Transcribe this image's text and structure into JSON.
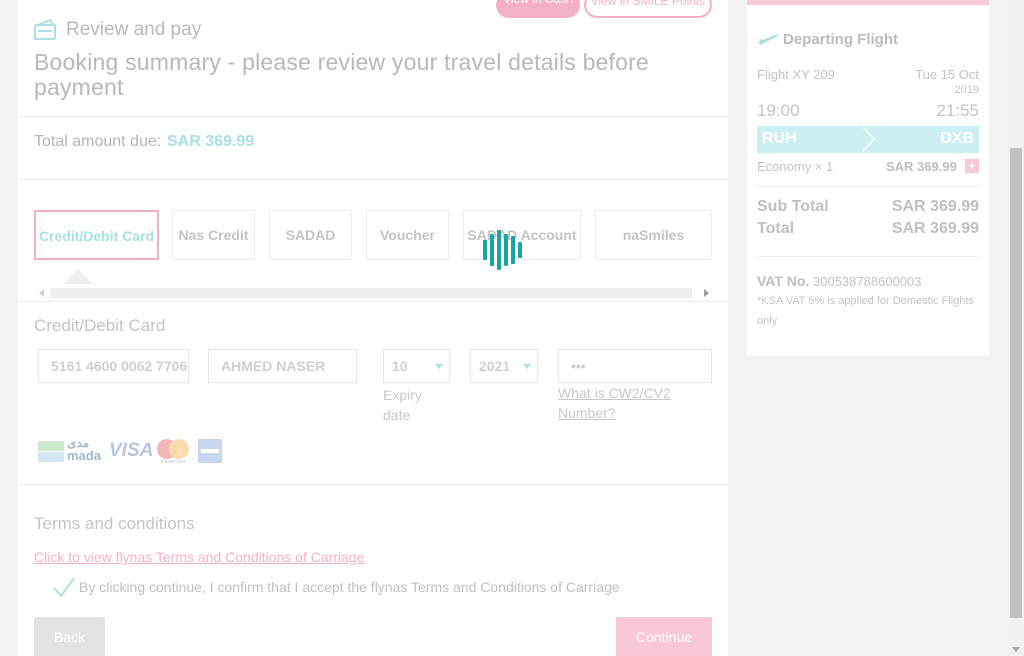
{
  "header": {
    "view_cash": "View in Cash",
    "view_points": "View in SMILE Points",
    "review_title": "Review and pay",
    "booking_title": "Booking summary - please review your travel details before payment"
  },
  "summary": {
    "total_label": "Total amount due:",
    "total_value": "SAR 369.99"
  },
  "payment_tabs": [
    {
      "label": "Credit/Debit Card",
      "active": true
    },
    {
      "label": "Nas Credit",
      "active": false
    },
    {
      "label": "SADAD",
      "active": false
    },
    {
      "label": "Voucher",
      "active": false
    },
    {
      "label": "SADAD Account",
      "active": false
    },
    {
      "label": "naSmiles",
      "active": false
    }
  ],
  "card_form": {
    "section_title": "Credit/Debit Card",
    "card_number": "5161 4600 0062 7706",
    "card_holder": "AHMED NASER",
    "expiry_month": "10",
    "expiry_year": "2021",
    "expiry_label_line1": "Expiry",
    "expiry_label_line2": "date",
    "cvv": "•••",
    "cvv_help_line1": "What is CW2/CV2",
    "cvv_help_line2": "Number?",
    "logo_mada_ar": "مدى",
    "logo_mada_en": "mada",
    "logo_visa": "VISA",
    "logo_mastercard": "mastercard"
  },
  "terms": {
    "section_title": "Terms and conditions",
    "link_text": "Click to view flynas Terms and Conditions of Carriage",
    "accept_text": "By clicking continue, I confirm that I accept the flynas Terms and Conditions of Carriage"
  },
  "buttons": {
    "back": "Back",
    "continue": "Continue"
  },
  "flight": {
    "title": "Departing Flight",
    "flight_no": "Flight XY 209",
    "date_line1": "Tue 15 Oct",
    "date_line2": "2019",
    "depart_time": "19:00",
    "arrive_time": "21:55",
    "origin": "RUH",
    "destination": "DXB",
    "cabin": "Economy × 1",
    "fare": "SAR 369.99",
    "plus": "+"
  },
  "totals": {
    "sub_total_label": "Sub Total",
    "sub_total_value": "SAR 369.99",
    "total_label": "Total",
    "total_value": "SAR 369.99"
  },
  "vat": {
    "label": "VAT No.",
    "number": "300538788600003",
    "note_line1": "*KSA VAT 5% is applied for Domestic Flights",
    "note_line2": "only"
  },
  "colors": {
    "accent_pink": "#f3b1c4",
    "accent_teal": "#a9e0e2",
    "loader_teal": "#1aa3a8"
  }
}
